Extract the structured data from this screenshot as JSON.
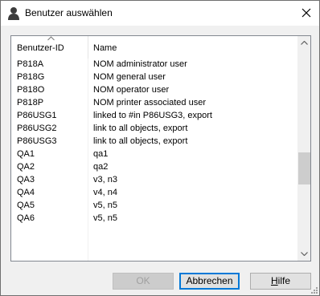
{
  "window": {
    "title": "Benutzer auswählen"
  },
  "icons": {
    "title": "user-icon",
    "close": "close-icon",
    "sort": "sort-ascending-arrow-icon",
    "scroll_up": "chevron-up-icon",
    "scroll_down": "chevron-down-icon"
  },
  "list": {
    "columns": [
      "Benutzer-ID",
      "Name"
    ],
    "rows": [
      {
        "id": "P818A",
        "name": "NOM administrator user"
      },
      {
        "id": "P818G",
        "name": "NOM general user"
      },
      {
        "id": "P818O",
        "name": "NOM operator user"
      },
      {
        "id": "P818P",
        "name": "NOM printer associated user"
      },
      {
        "id": "P86USG1",
        "name": "linked to #in P86USG3, export"
      },
      {
        "id": "P86USG2",
        "name": "link to all objects, export"
      },
      {
        "id": "P86USG3",
        "name": "link to all objects, export"
      },
      {
        "id": "QA1",
        "name": "qa1"
      },
      {
        "id": "QA2",
        "name": "qa2"
      },
      {
        "id": "QA3",
        "name": "v3, n3"
      },
      {
        "id": "QA4",
        "name": "v4, n4"
      },
      {
        "id": "QA5",
        "name": "v5, n5"
      },
      {
        "id": "QA6",
        "name": "v5, n5"
      }
    ]
  },
  "buttons": {
    "ok": "OK",
    "cancel": "Abbrechen",
    "help_mnemonic": "H",
    "help_rest": "ilfe"
  },
  "colors": {
    "focus_border": "#0078d7",
    "disabled_text": "#a0a0a0",
    "scroll_thumb": "#cdcdcd"
  }
}
